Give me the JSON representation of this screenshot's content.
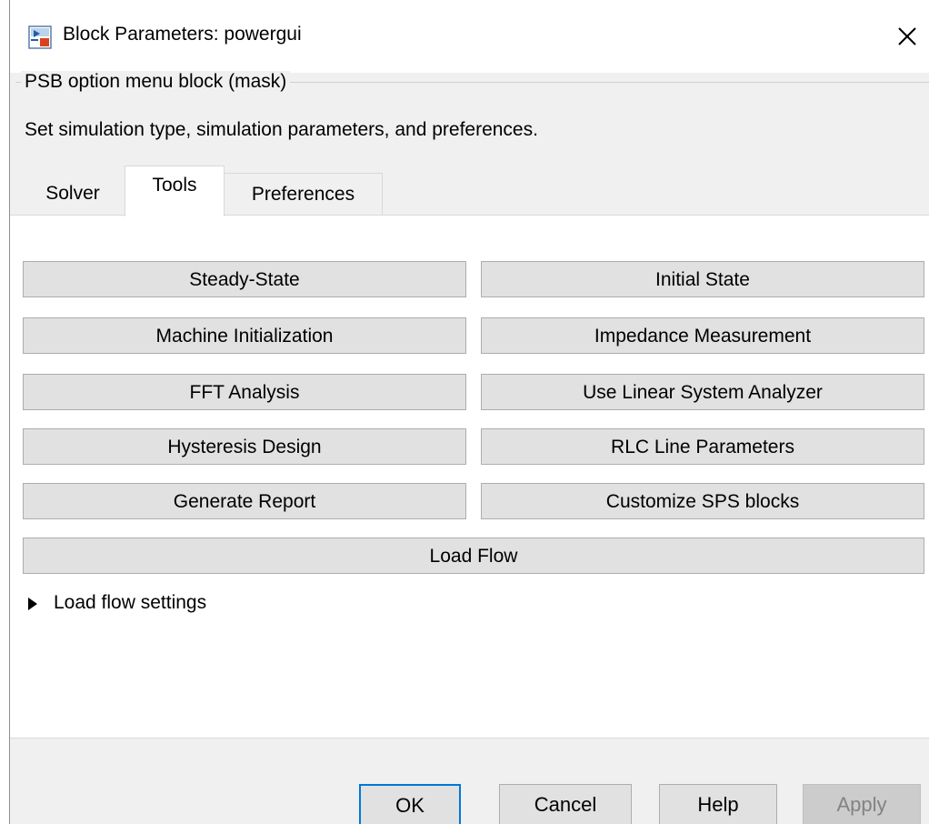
{
  "window": {
    "title": "Block Parameters: powergui",
    "icon": "simulink-block-icon",
    "close_icon": "close-icon"
  },
  "mask": {
    "group_title": "PSB option menu block (mask)",
    "description": "Set simulation type, simulation parameters, and preferences."
  },
  "tabs": [
    {
      "label": "Solver",
      "selected": false
    },
    {
      "label": "Tools",
      "selected": true
    },
    {
      "label": "Preferences",
      "selected": false
    }
  ],
  "tools": {
    "buttons": [
      {
        "label": "Steady-State"
      },
      {
        "label": "Initial State"
      },
      {
        "label": "Machine Initialization"
      },
      {
        "label": "Impedance Measurement"
      },
      {
        "label": "FFT Analysis"
      },
      {
        "label": "Use Linear System Analyzer"
      },
      {
        "label": "Hysteresis Design"
      },
      {
        "label": "RLC Line Parameters"
      },
      {
        "label": "Generate Report"
      },
      {
        "label": "Customize SPS blocks"
      },
      {
        "label": "Load Flow"
      }
    ],
    "load_flow_settings": {
      "label": "Load flow settings",
      "expanded": false,
      "icon": "expand-triangle-icon"
    }
  },
  "footer": {
    "ok": "OK",
    "cancel": "Cancel",
    "help": "Help",
    "apply": "Apply",
    "apply_enabled": false
  },
  "colors": {
    "focus_border": "#0078d7",
    "button_face": "#e1e1e1",
    "dialog_background": "#f0f0f0"
  }
}
